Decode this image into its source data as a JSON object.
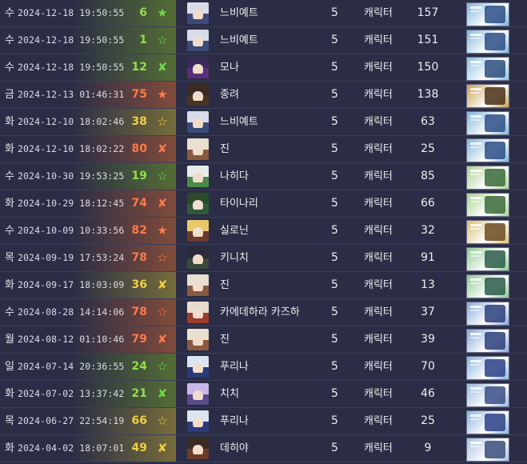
{
  "rows": [
    {
      "day": "수",
      "date": "2024-12-18 19:50:55",
      "pity": "6",
      "pity_color": "#8fe04a",
      "badge": "★",
      "badge_color": "#6fdc4a",
      "glow": "rgba(120,160,40,0.55)",
      "name": "느비예트",
      "star": "5",
      "type": "캐릭터",
      "count": "157",
      "avatar_hair": "#d8dce8",
      "avatar_body": "#3b4a7a",
      "banner_bg": "#7fb6d8",
      "banner_fg": "#2c4e86"
    },
    {
      "day": "수",
      "date": "2024-12-18 19:50:55",
      "pity": "1",
      "pity_color": "#8fe04a",
      "badge": "☆",
      "badge_color": "#6fdc4a",
      "glow": "rgba(120,160,40,0.55)",
      "name": "느비예트",
      "star": "5",
      "type": "캐릭터",
      "count": "151",
      "avatar_hair": "#d8dce8",
      "avatar_body": "#3b4a7a",
      "banner_bg": "#7fb6d8",
      "banner_fg": "#2c4e86"
    },
    {
      "day": "수",
      "date": "2024-12-18 19:50:55",
      "pity": "12",
      "pity_color": "#8fe04a",
      "badge": "✘",
      "badge_color": "#6fdc4a",
      "glow": "rgba(120,160,40,0.55)",
      "name": "모나",
      "star": "5",
      "type": "캐릭터",
      "count": "150",
      "avatar_hair": "#3a2a5a",
      "avatar_body": "#5a2e7a",
      "banner_bg": "#8cc0e0",
      "banner_fg": "#2a4c7e"
    },
    {
      "day": "금",
      "date": "2024-12-13 01:46:31",
      "pity": "75",
      "pity_color": "#ff7a4a",
      "badge": "★",
      "badge_color": "#ff7a4a",
      "glow": "rgba(200,100,50,0.55)",
      "name": "종려",
      "star": "5",
      "type": "캐릭터",
      "count": "138",
      "avatar_hair": "#3a2a22",
      "avatar_body": "#4a3424",
      "banner_bg": "#c8a050",
      "banner_fg": "#4a3018"
    },
    {
      "day": "화",
      "date": "2024-12-10 18:02:46",
      "pity": "38",
      "pity_color": "#f0d040",
      "badge": "☆",
      "badge_color": "#f0d040",
      "glow": "rgba(180,160,50,0.55)",
      "name": "느비예트",
      "star": "5",
      "type": "캐릭터",
      "count": "63",
      "avatar_hair": "#d8dce8",
      "avatar_body": "#3b4a7a",
      "banner_bg": "#7fb6d8",
      "banner_fg": "#2c4e86"
    },
    {
      "day": "화",
      "date": "2024-12-10 18:02:22",
      "pity": "80",
      "pity_color": "#ff7a4a",
      "badge": "✘",
      "badge_color": "#ff7a4a",
      "glow": "rgba(200,100,50,0.55)",
      "name": "진",
      "star": "5",
      "type": "캐릭터",
      "count": "25",
      "avatar_hair": "#e8e0d0",
      "avatar_body": "#8a5a40",
      "banner_bg": "#7fb6d8",
      "banner_fg": "#2c4e86"
    },
    {
      "day": "수",
      "date": "2024-10-30 19:53:25",
      "pity": "19",
      "pity_color": "#8fe04a",
      "badge": "☆",
      "badge_color": "#6fdc4a",
      "glow": "rgba(120,160,40,0.55)",
      "name": "나히다",
      "star": "5",
      "type": "캐릭터",
      "count": "85",
      "avatar_hair": "#e8ece8",
      "avatar_body": "#4a8a4a",
      "banner_bg": "#a8d090",
      "banner_fg": "#3a6a3a"
    },
    {
      "day": "화",
      "date": "2024-10-29 18:12:45",
      "pity": "74",
      "pity_color": "#ff7a4a",
      "badge": "✘",
      "badge_color": "#ff7a4a",
      "glow": "rgba(200,100,50,0.55)",
      "name": "타이나리",
      "star": "5",
      "type": "캐릭터",
      "count": "66",
      "avatar_hair": "#2a4a2a",
      "avatar_body": "#2e5a3a",
      "banner_bg": "#a8d090",
      "banner_fg": "#3a6a3a"
    },
    {
      "day": "수",
      "date": "2024-10-09 10:33:56",
      "pity": "82",
      "pity_color": "#ff7a4a",
      "badge": "★",
      "badge_color": "#ff7a4a",
      "glow": "rgba(200,100,50,0.55)",
      "name": "실로닌",
      "star": "5",
      "type": "캐릭터",
      "count": "32",
      "avatar_hair": "#e8c86a",
      "avatar_body": "#6a3a2a",
      "banner_bg": "#d8c070",
      "banner_fg": "#6a4a20"
    },
    {
      "day": "목",
      "date": "2024-09-19 17:53:24",
      "pity": "78",
      "pity_color": "#ff7a4a",
      "badge": "☆",
      "badge_color": "#ff7a4a",
      "glow": "rgba(200,100,50,0.55)",
      "name": "키니치",
      "star": "5",
      "type": "캐릭터",
      "count": "91",
      "avatar_hair": "#2a2a3a",
      "avatar_body": "#3a4a3a",
      "banner_bg": "#90c890",
      "banner_fg": "#2a5a4a"
    },
    {
      "day": "화",
      "date": "2024-09-17 18:03:09",
      "pity": "36",
      "pity_color": "#f0d040",
      "badge": "✘",
      "badge_color": "#f0d040",
      "glow": "rgba(180,160,50,0.55)",
      "name": "진",
      "star": "5",
      "type": "캐릭터",
      "count": "13",
      "avatar_hair": "#e8e0d0",
      "avatar_body": "#8a5a40",
      "banner_bg": "#90c890",
      "banner_fg": "#2a5a4a"
    },
    {
      "day": "수",
      "date": "2024-08-28 14:14:06",
      "pity": "78",
      "pity_color": "#ff7a4a",
      "badge": "☆",
      "badge_color": "#ff7a4a",
      "glow": "rgba(200,100,50,0.55)",
      "name": "카에데하라 카즈하",
      "star": "5",
      "type": "캐릭터",
      "count": "37",
      "avatar_hair": "#e8dccc",
      "avatar_body": "#a03a2a",
      "banner_bg": "#88a8d8",
      "banner_fg": "#2a3e7a"
    },
    {
      "day": "월",
      "date": "2024-08-12 01:10:46",
      "pity": "79",
      "pity_color": "#ff7a4a",
      "badge": "✘",
      "badge_color": "#ff7a4a",
      "glow": "rgba(200,100,50,0.55)",
      "name": "진",
      "star": "5",
      "type": "캐릭터",
      "count": "39",
      "avatar_hair": "#e8e0d0",
      "avatar_body": "#8a5a40",
      "banner_bg": "#88a8d8",
      "banner_fg": "#2a3e7a"
    },
    {
      "day": "일",
      "date": "2024-07-14 20:36:55",
      "pity": "24",
      "pity_color": "#8fe04a",
      "badge": "☆",
      "badge_color": "#6fdc4a",
      "glow": "rgba(120,160,40,0.55)",
      "name": "푸리나",
      "star": "5",
      "type": "캐릭터",
      "count": "70",
      "avatar_hair": "#dce4f0",
      "avatar_body": "#2a3a7a",
      "banner_bg": "#8ab4e0",
      "banner_fg": "#2a3e86"
    },
    {
      "day": "화",
      "date": "2024-07-02 13:37:42",
      "pity": "21",
      "pity_color": "#8fe04a",
      "badge": "✘",
      "badge_color": "#6fdc4a",
      "glow": "rgba(120,160,40,0.55)",
      "name": "치치",
      "star": "5",
      "type": "캐릭터",
      "count": "46",
      "avatar_hair": "#c8b8e8",
      "avatar_body": "#5a4a8a",
      "banner_bg": "#9ab8dc",
      "banner_fg": "#3a4e86"
    },
    {
      "day": "목",
      "date": "2024-06-27 22:54:19",
      "pity": "66",
      "pity_color": "#f0d040",
      "badge": "☆",
      "badge_color": "#f0d040",
      "glow": "rgba(180,160,50,0.55)",
      "name": "푸리나",
      "star": "5",
      "type": "캐릭터",
      "count": "25",
      "avatar_hair": "#dce4f0",
      "avatar_body": "#2a3a7a",
      "banner_bg": "#8ab4e0",
      "banner_fg": "#2a3e86"
    },
    {
      "day": "화",
      "date": "2024-04-02 18:07:01",
      "pity": "49",
      "pity_color": "#f0d040",
      "badge": "✘",
      "badge_color": "#f0d040",
      "glow": "rgba(180,160,50,0.55)",
      "name": "데히야",
      "star": "5",
      "type": "캐릭터",
      "count": "9",
      "avatar_hair": "#3a2a22",
      "avatar_body": "#6a3a2a",
      "banner_bg": "#a8c0e0",
      "banner_fg": "#3a4e7a"
    }
  ]
}
